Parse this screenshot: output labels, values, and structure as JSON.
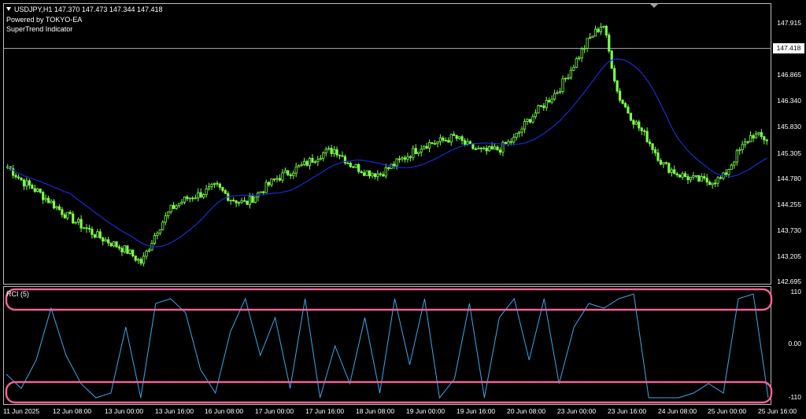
{
  "header": {
    "symbol_line": "USDJPY,H1  147.370 147.473 147.344 147.418",
    "powered_by": "Powered by TOKYO-EA",
    "indicator_name": "SuperTrend Indicator"
  },
  "price_axis": {
    "labels": [
      "147.915",
      "147.418",
      "146.865",
      "146.340",
      "145.830",
      "145.305",
      "144.780",
      "144.255",
      "143.730",
      "143.205",
      "142.695"
    ],
    "current_price": "147.418"
  },
  "rci_panel": {
    "label": "RCI (5)",
    "levels": [
      "110",
      "0.00",
      "-110"
    ]
  },
  "time_axis": {
    "labels": [
      "11 Jun 2025",
      "12 Jun 08:00",
      "13 Jun 00:00",
      "13 Jun 16:00",
      "16 Jun 08:00",
      "17 Jun 00:00",
      "17 Jun 16:00",
      "18 Jun 08:00",
      "19 Jun 00:00",
      "19 Jun 16:00",
      "20 Jun 08:00",
      "23 Jun 00:00",
      "23 Jun 16:00",
      "24 Jun 08:00",
      "25 Jun 00:00",
      "25 Jun 16:00"
    ]
  },
  "colors": {
    "background": "#000000",
    "candles": "#7CFC4C",
    "moving_average": "#1a2bd6",
    "rci_line": "#3aa7e8",
    "highlight": "#f06292",
    "grid_border": "#bdbdbd"
  },
  "chart_data": [
    {
      "type": "line",
      "title": "USDJPY,H1",
      "series": [
        {
          "name": "USDJPY,H1",
          "values": [
            145.05,
            144.75,
            144.55,
            144.3,
            144.05,
            143.85,
            143.65,
            143.5,
            143.35,
            143.1,
            143.75,
            144.2,
            144.4,
            144.5,
            144.65,
            144.4,
            144.3,
            144.55,
            144.8,
            144.95,
            145.1,
            145.3,
            145.4,
            145.1,
            144.95,
            144.9,
            145.1,
            145.3,
            145.5,
            145.55,
            145.65,
            145.45,
            145.35,
            145.4,
            145.6,
            146.0,
            146.3,
            146.6,
            147.1,
            147.6,
            147.95,
            146.5,
            146.0,
            145.6,
            145.1,
            144.9,
            144.8,
            144.75,
            144.8,
            145.3,
            145.7,
            145.6
          ]
        }
      ],
      "ylim": [
        142.695,
        148.1
      ],
      "grid": false
    },
    {
      "type": "line",
      "series": [
        {
          "name": "RCI (5)",
          "values": [
            -60,
            -90,
            -30,
            80,
            -20,
            -80,
            -110,
            -100,
            40,
            -110,
            90,
            100,
            70,
            -50,
            -100,
            30,
            100,
            -20,
            60,
            -90,
            100,
            -110,
            0,
            -80,
            60,
            -100,
            100,
            -40,
            100,
            -110,
            -70,
            90,
            -110,
            60,
            100,
            -30,
            100,
            -80,
            40,
            90,
            80,
            100,
            110,
            -110,
            -110,
            -110,
            -100,
            -80,
            -100,
            100,
            110,
            -110
          ]
        }
      ],
      "ylim": [
        -110,
        110
      ],
      "grid": false
    }
  ]
}
